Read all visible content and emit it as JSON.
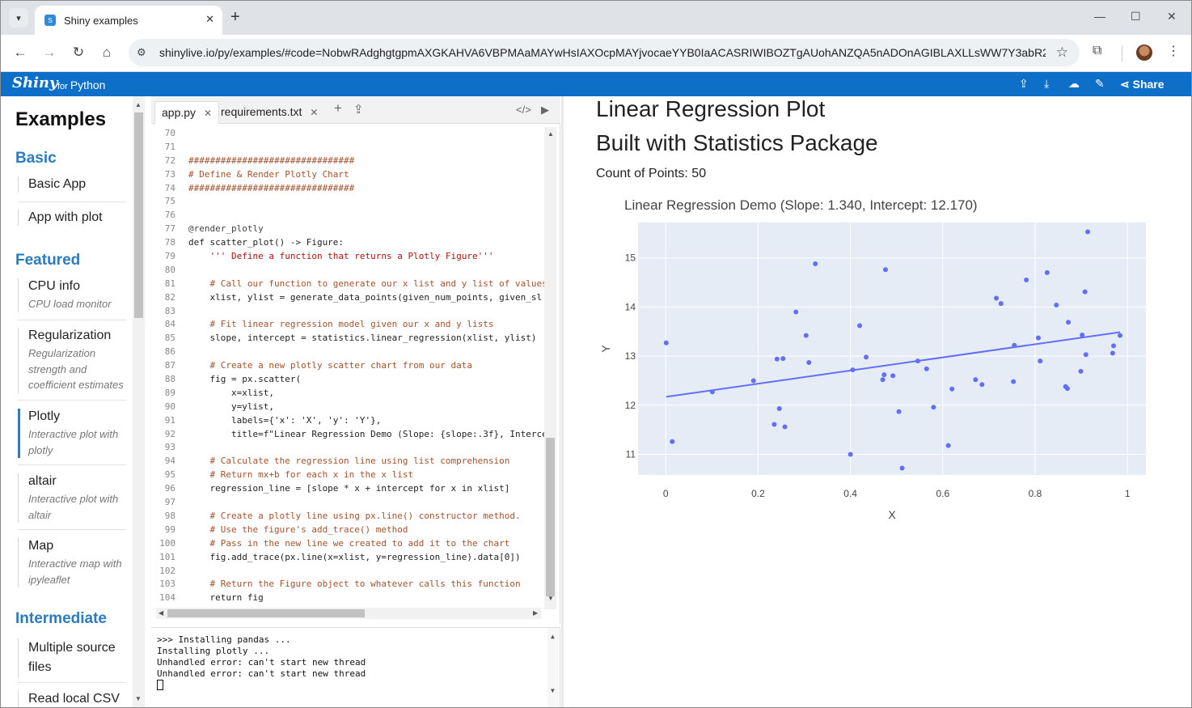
{
  "browser": {
    "tab_title": "Shiny examples",
    "url": "shinylive.io/py/examples/#code=NobwRAdghgtgpmAXGKAHVA6VBPMAaMAYwHsIAXOcpMAYjvocaeYYB0IaACASRIWIBOZTgAUohANZQA5nADOnAGIBLAXLLsWW7Y3abR2MgA..."
  },
  "header": {
    "logo": "Shiny",
    "for_label": "for",
    "python_label": "Python",
    "share_label": "Share"
  },
  "sidebar": {
    "title": "Examples",
    "sections": {
      "basic": "Basic",
      "featured": "Featured",
      "intermediate": "Intermediate"
    },
    "items": {
      "basic_app": "Basic App",
      "app_with_plot": "App with plot",
      "cpu_info": {
        "title": "CPU info",
        "desc": "CPU load monitor"
      },
      "regularization": {
        "title": "Regularization",
        "desc": "Regularization strength and coefficient estimates"
      },
      "plotly": {
        "title": "Plotly",
        "desc": "Interactive plot with plotly"
      },
      "altair": {
        "title": "altair",
        "desc": "Interactive plot with altair"
      },
      "map": {
        "title": "Map",
        "desc": "Interactive map with ipyleaflet"
      },
      "multiple_source": "Multiple source files",
      "read_local_csv": "Read local CSV"
    }
  },
  "editor": {
    "tabs": [
      "app.py",
      "requirements.txt"
    ],
    "line_numbers": [
      "70",
      "71",
      "72",
      "73",
      "74",
      "75",
      "76",
      "77",
      "78",
      "79",
      "80",
      "81",
      "82",
      "83",
      "84",
      "85",
      "86",
      "87",
      "88",
      "89",
      "90",
      "91",
      "92",
      "93",
      "94",
      "95",
      "96",
      "97",
      "98",
      "99",
      "100",
      "101",
      "102",
      "103",
      "104"
    ],
    "code": [
      "",
      "",
      "###############################",
      "# Define & Render Plotly Chart",
      "###############################",
      "",
      "",
      "@render_plotly",
      "def scatter_plot() -> Figure:",
      "    ''' Define a function that returns a Plotly Figure'''",
      "",
      "    # Call our function to generate our x list and y list of values",
      "    xlist, ylist = generate_data_points(given_num_points, given_sl",
      "",
      "    # Fit linear regression model given our x and y lists",
      "    slope, intercept = statistics.linear_regression(xlist, ylist)",
      "",
      "    # Create a new plotly scatter chart from our data",
      "    fig = px.scatter(",
      "        x=xlist,",
      "        y=ylist,",
      "        labels={'x': 'X', 'y': 'Y'},",
      "        title=f\"Linear Regression Demo (Slope: {slope:.3f}, Interce",
      "",
      "    # Calculate the regression line using list comprehension",
      "    # Return mx+b for each x in the x list",
      "    regression_line = [slope * x + intercept for x in xlist]",
      "",
      "    # Create a plotly line using px.line() constructor method.",
      "    # Use the figure's add_trace() method",
      "    # Pass in the new line we created to add it to the chart",
      "    fig.add_trace(px.line(x=xlist, y=regression_line).data[0])",
      "",
      "    # Return the Figure object to whatever calls this function",
      "    return fig"
    ]
  },
  "console": {
    "lines": [
      ">>> Installing pandas ...",
      "Installing plotly ...",
      "Unhandled error: can't start new thread",
      "Unhandled error: can't start new thread"
    ]
  },
  "output": {
    "title_line1": "Linear Regression Plot",
    "title_line2": "Built with Statistics Package",
    "count_text": "Count of Points: 50"
  },
  "colors": {
    "brand": "#0d6fc7",
    "marker": "#636efa",
    "plot_bg": "#e5ecf6",
    "section": "#2a7bc0"
  },
  "chart_data": {
    "type": "scatter",
    "title": "Linear Regression Demo (Slope: 1.340, Intercept: 12.170)",
    "xlabel": "X",
    "ylabel": "Y",
    "xlim": [
      -0.06,
      1.04
    ],
    "ylim": [
      10.58,
      15.72
    ],
    "xticks": [
      0,
      0.2,
      0.4,
      0.6,
      0.8,
      1
    ],
    "xtick_labels": [
      "0",
      "0.2",
      "0.4",
      "0.6",
      "0.8",
      "1"
    ],
    "yticks": [
      11,
      12,
      13,
      14,
      15
    ],
    "ytick_labels": [
      "11",
      "12",
      "13",
      "14",
      "15"
    ],
    "grid": true,
    "points": [
      [
        0.001,
        13.27
      ],
      [
        0.014,
        11.26
      ],
      [
        0.101,
        12.27
      ],
      [
        0.19,
        12.5
      ],
      [
        0.235,
        11.61
      ],
      [
        0.241,
        12.94
      ],
      [
        0.246,
        11.93
      ],
      [
        0.254,
        12.95
      ],
      [
        0.258,
        11.56
      ],
      [
        0.282,
        13.9
      ],
      [
        0.304,
        13.42
      ],
      [
        0.31,
        12.87
      ],
      [
        0.324,
        14.88
      ],
      [
        0.4,
        11.0
      ],
      [
        0.405,
        12.72
      ],
      [
        0.42,
        13.62
      ],
      [
        0.434,
        12.98
      ],
      [
        0.47,
        12.52
      ],
      [
        0.473,
        12.62
      ],
      [
        0.476,
        14.76
      ],
      [
        0.492,
        12.6
      ],
      [
        0.505,
        11.87
      ],
      [
        0.512,
        10.72
      ],
      [
        0.546,
        12.9
      ],
      [
        0.565,
        12.74
      ],
      [
        0.58,
        11.96
      ],
      [
        0.612,
        11.18
      ],
      [
        0.62,
        12.33
      ],
      [
        0.671,
        12.52
      ],
      [
        0.685,
        12.42
      ],
      [
        0.716,
        14.18
      ],
      [
        0.726,
        14.07
      ],
      [
        0.753,
        12.48
      ],
      [
        0.755,
        13.22
      ],
      [
        0.781,
        14.55
      ],
      [
        0.807,
        13.37
      ],
      [
        0.811,
        12.9
      ],
      [
        0.826,
        14.7
      ],
      [
        0.846,
        14.04
      ],
      [
        0.866,
        12.38
      ],
      [
        0.87,
        12.34
      ],
      [
        0.872,
        13.69
      ],
      [
        0.899,
        12.69
      ],
      [
        0.902,
        13.43
      ],
      [
        0.908,
        14.31
      ],
      [
        0.91,
        13.03
      ],
      [
        0.914,
        15.53
      ],
      [
        0.968,
        13.06
      ],
      [
        0.97,
        13.21
      ],
      [
        0.984,
        13.42
      ]
    ],
    "regression": {
      "slope": 1.34,
      "intercept": 12.17,
      "x_range": [
        0.001,
        0.984
      ]
    },
    "marker_color": "#636efa"
  }
}
